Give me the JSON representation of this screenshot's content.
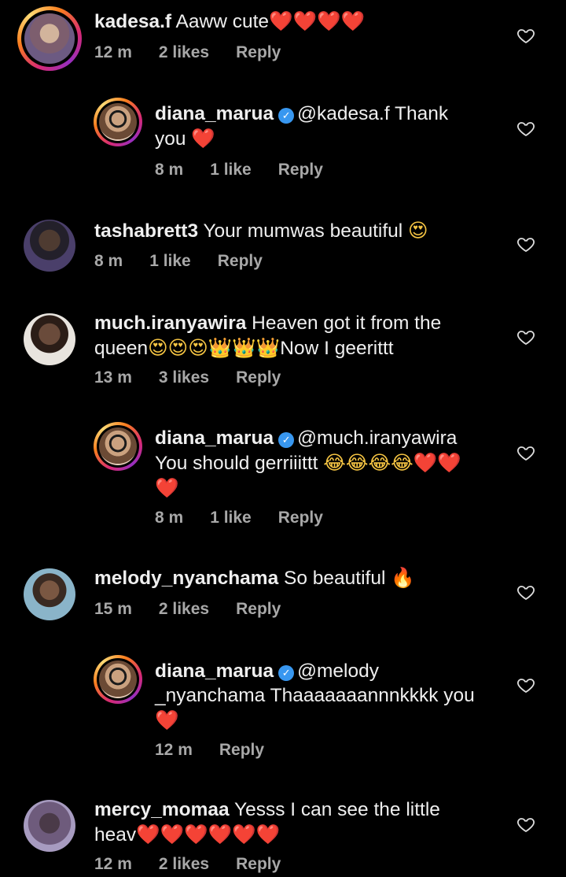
{
  "comments": [
    {
      "user": "kadesa.f",
      "text": "Aaww cute",
      "emoji": "❤️❤️❤️❤️",
      "time": "12 m",
      "likes": "2 likes",
      "reply": "Reply"
    },
    {
      "user": "diana_marua",
      "mention": "@kadesa.f",
      "text": " Thank",
      "line2": "you",
      "emoji": "❤️",
      "time": "8 m",
      "likes": "1 like",
      "reply": "Reply"
    },
    {
      "user": "tashabrett3",
      "text": "Your mumwas beautiful",
      "emoji": "😍",
      "time": "8 m",
      "likes": "1 like",
      "reply": "Reply"
    },
    {
      "user": "much.iranyawira",
      "text": "Heaven got it from the",
      "line2": "queen",
      "emoji": "😍😍😍👑👑👑",
      "after": "Now I geerittt",
      "time": "13 m",
      "likes": "3 likes",
      "reply": "Reply"
    },
    {
      "user": "diana_marua",
      "mention": "@much.iranyawira",
      "line2": "You should  gerriiittt",
      "emoji": "😂😂😂😂❤️❤️",
      "line3": "❤️",
      "time": "8 m",
      "likes": "1 like",
      "reply": "Reply"
    },
    {
      "user": "melody_nyanchama",
      "text": "So beautiful",
      "emoji": "🔥",
      "time": "15 m",
      "likes": "2 likes",
      "reply": "Reply"
    },
    {
      "user": "diana_marua",
      "mention": "@melody",
      "line2": "_nyanchama Thaaaaaaannnkkkk you",
      "line3": "❤️",
      "time": "12 m",
      "reply": "Reply"
    },
    {
      "user": "mercy_momaa",
      "text": "Yesss I can see the little",
      "line2": "heav",
      "emoji": "❤️❤️❤️❤️❤️❤️",
      "time": "12 m",
      "likes": "2 likes",
      "reply": "Reply"
    }
  ]
}
